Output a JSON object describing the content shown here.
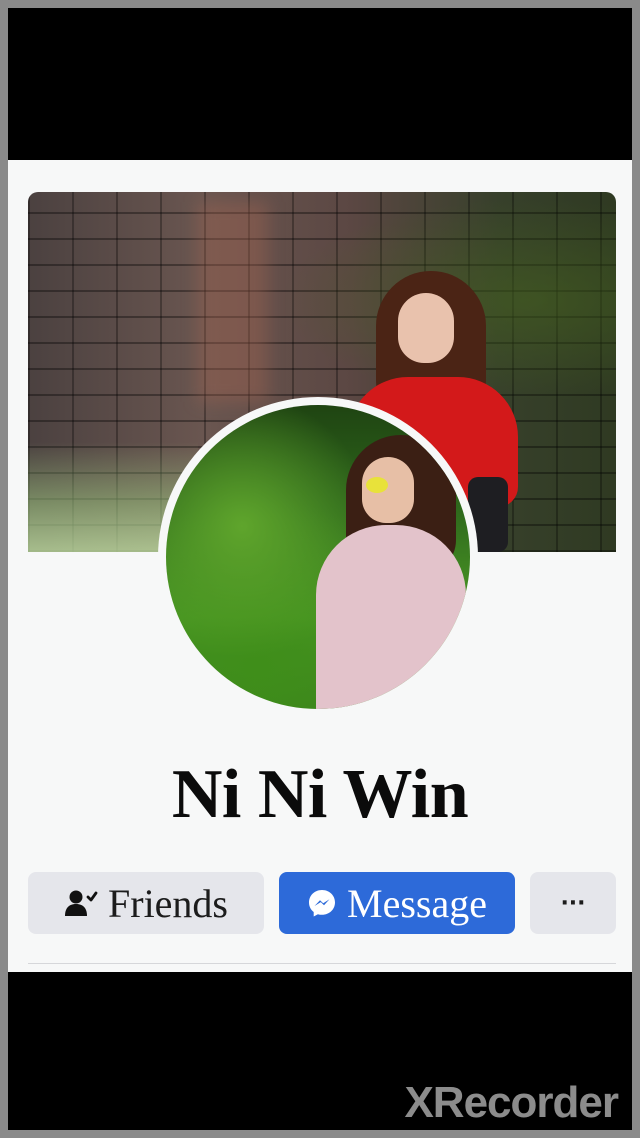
{
  "profile": {
    "name": "Ni Ni Win"
  },
  "actions": {
    "friends_label": "Friends",
    "message_label": "Message",
    "more_label": "···"
  },
  "icons": {
    "friends": "person-check-icon",
    "message": "messenger-icon",
    "more": "more-options-icon"
  },
  "colors": {
    "message_button": "#2d6ad9",
    "secondary_button": "#e5e6eb",
    "card_background": "#f7f8f8"
  },
  "watermark": {
    "text": "XRecorder"
  }
}
